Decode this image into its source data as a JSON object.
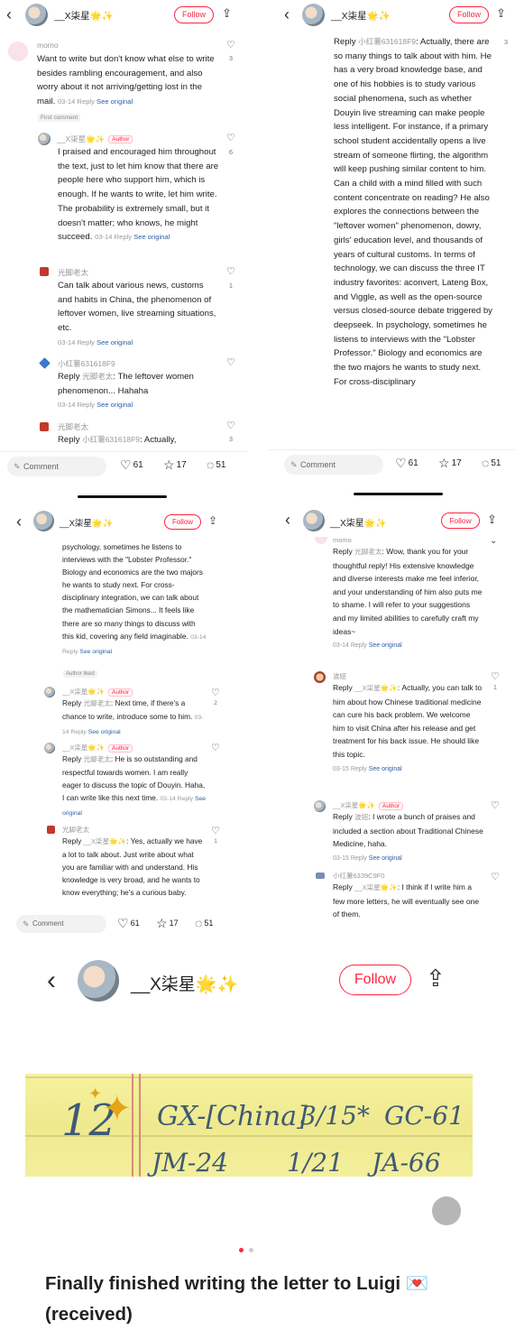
{
  "header": {
    "author": "__X柒星🌟✨",
    "follow_label": "Follow"
  },
  "bottom_bar": {
    "comment_placeholder": "Comment",
    "likes": "61",
    "stars": "17",
    "comments": "51"
  },
  "panel1": {
    "comments": [
      {
        "name": "momo",
        "text": "Want to write but don't know what else to write besides rambling encouragement, and also worry about it not arriving/getting lost in the mail.",
        "date": "03-14",
        "reply": "Reply",
        "see": "See original",
        "likes": "3",
        "tag": "First comment"
      },
      {
        "name": "__X柒星🌟✨",
        "badge": "Author",
        "text": "I praised and encouraged him throughout the text, just to let him know that there are people here who support him, which is enough. If he wants to write, let him write. The probability is extremely small, but it doesn't matter; who knows, he might succeed.",
        "date": "03-14",
        "reply": "Reply",
        "see": "See original",
        "likes": "6"
      },
      {
        "name": "光脚老太",
        "text": "Can talk about various news, customs and habits in China, the phenomenon of leftover women, live streaming situations, etc.",
        "date": "03-14",
        "reply": "Reply",
        "see": "See original",
        "likes": "1"
      },
      {
        "name": "小红薯631618F9",
        "reply_to": "光脚老太",
        "text": "The leftover women phenomenon... Hahaha",
        "date": "03-14",
        "reply": "Reply",
        "see": "See original"
      },
      {
        "name": "光脚老太",
        "reply_to": "小红薯631618F9",
        "text": "Actually,",
        "likes": "3"
      }
    ]
  },
  "panel2": {
    "reply_to": "小红薯631618F9",
    "text": "Actually, there are so many things to talk about with him. He has a very broad knowledge base, and one of his hobbies is to study various social phenomena, such as whether Douyin live streaming can make people less intelligent. For instance, if a primary school student accidentally opens a live stream of someone flirting, the algorithm will keep pushing similar content to him. Can a child with a mind filled with such content concentrate on reading? He also explores the connections between the \"leftover women\" phenomenon, dowry, girls' education level, and thousands of years of cultural customs. In terms of technology, we can discuss the three IT industry favorites: aconvert, Lateng Box, and Viggle, as well as the open-source versus closed-source debate triggered by deepseek. In psychology, sometimes he listens to interviews with the \"Lobster Professor.\" Biology and economics are the two majors he wants to study next. For cross-disciplinary",
    "likes": "3"
  },
  "panel3": {
    "cont_text": "psychology, sometimes he listens to interviews with the \"Lobster Professor.\" Biology and economics are the two majors he wants to study next. For cross-disciplinary integration, we can talk about the mathematician Simons... It feels like there are so many things to discuss with this kid, covering any field imaginable.",
    "cont_date": "03-14",
    "cont_reply": "Reply",
    "cont_see": "See original",
    "author_liked": "Author liked",
    "comments": [
      {
        "name": "__X柒星🌟✨",
        "badge": "Author",
        "reply_to": "光脚老太",
        "text": "Next time, if there's a chance to write, introduce some to him.",
        "date": "03-14",
        "reply": "Reply",
        "see": "See original",
        "likes": "2"
      },
      {
        "name": "__X柒星🌟✨",
        "badge": "Author",
        "reply_to": "光脚老太",
        "text": "He is so outstanding and respectful towards women. I am really eager to discuss the topic of Douyin. Haha, I can write like this next time.",
        "date": "03-14",
        "reply": "Reply",
        "see": "See original"
      },
      {
        "name": "光脚老太",
        "reply_to": "__X柒星🌟✨",
        "text": "Yes, actually we have a lot to talk about. Just write about what you are familiar with and understand. His knowledge is very broad, and he wants to know everything; he's a curious baby.",
        "likes": "1"
      }
    ]
  },
  "panel4": {
    "comments": [
      {
        "name": "momo",
        "reply_to": "光脚老太",
        "text": "Wow, thank you for your thoughtful reply! His extensive knowledge and diverse interests make me feel inferior, and your understanding of him also puts me to shame. I will refer to your suggestions and my limited abilities to carefully craft my ideas~",
        "date": "03-14",
        "reply": "Reply",
        "see": "See original"
      },
      {
        "name": "波妞",
        "reply_to": "__X柒星🌟✨",
        "text": "Actually, you can talk to him about how Chinese traditional medicine can cure his back problem. We welcome him to visit China after his release and get treatment for his back issue. He should like this topic.",
        "date": "03-15",
        "reply": "Reply",
        "see": "See original",
        "likes": "1"
      },
      {
        "name": "__X柒星🌟✨",
        "badge": "Author",
        "reply_to": "波妞",
        "text": "I wrote a bunch of praises and included a section about Traditional Chinese Medicine, haha.",
        "date": "03-15",
        "reply": "Reply",
        "see": "See original"
      },
      {
        "name": "小红薯6339C9F0",
        "reply_to": "__X柒星🌟✨",
        "text": "I think if I write him a few more letters, he will eventually see one of them."
      }
    ]
  },
  "post": {
    "author": "__X柒星🌟✨",
    "follow_label": "Follow",
    "image_text": {
      "line1": "12",
      "line1b": "GX-[China]",
      "line1c": "3/15*",
      "line1d": "GC-61",
      "line2a": "JM-24",
      "line2b": "1/21",
      "line2c": "JA-66"
    },
    "title": "Finally finished writing the letter to Luigi 💌 (received)"
  }
}
